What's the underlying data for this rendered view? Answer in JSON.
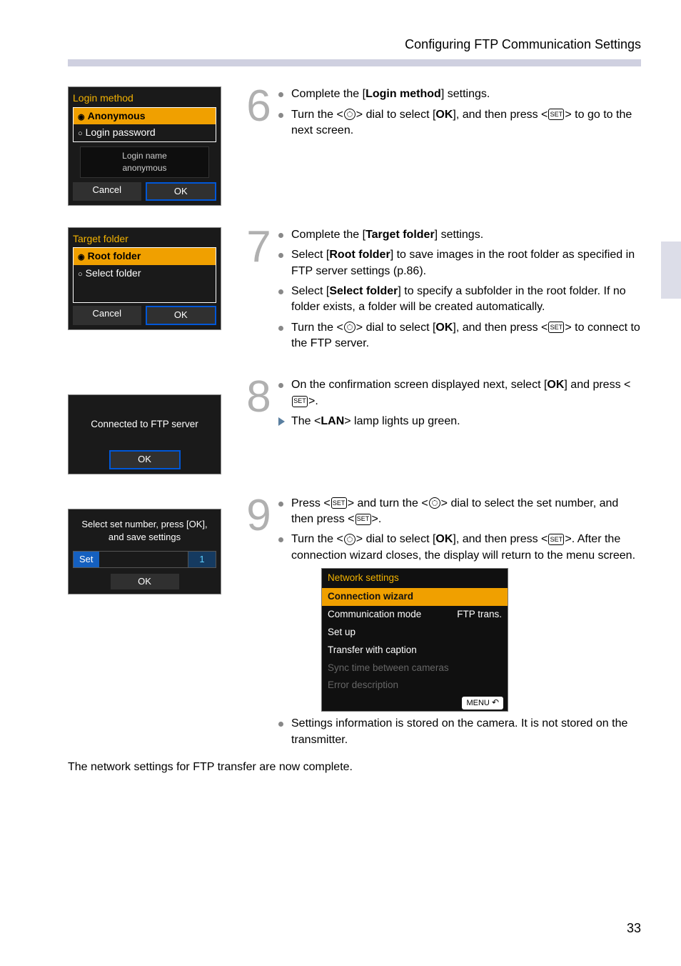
{
  "header": {
    "title": "Configuring FTP Communication Settings"
  },
  "page_number": "33",
  "steps": {
    "s6": {
      "num": "6",
      "panel": {
        "title": "Login method",
        "opt_sel": "Anonymous",
        "opt_other": "Login password",
        "sub_l1": "Login name",
        "sub_l2": "anonymous",
        "btn_l": "Cancel",
        "btn_r": "OK"
      },
      "b1_a": "Complete the [",
      "b1_bold": "Login method",
      "b1_b": "] settings.",
      "b2_a": "Turn the <",
      "b2_b": "> dial to select [",
      "b2_ok": "OK",
      "b2_c": "], and then press <",
      "b2_d": "> to go to the next screen."
    },
    "s7": {
      "num": "7",
      "panel": {
        "title": "Target folder",
        "opt_sel": "Root folder",
        "opt_other": "Select folder",
        "btn_l": "Cancel",
        "btn_r": "OK"
      },
      "b1_a": "Complete the [",
      "b1_bold": "Target folder",
      "b1_b": "] settings.",
      "b2_a": "Select [",
      "b2_bold": "Root folder",
      "b2_b": "] to save images in the root folder as specified in FTP server settings (p.86).",
      "b3_a": "Select [",
      "b3_bold": "Select folder",
      "b3_b": "] to specify a subfolder in the root folder. If no folder exists, a folder will be created automatically.",
      "b4_a": "Turn the <",
      "b4_b": "> dial to select [",
      "b4_ok": "OK",
      "b4_c": "], and then press <",
      "b4_d": "> to connect to the FTP server."
    },
    "s8": {
      "num": "8",
      "panel": {
        "msg": "Connected to FTP server",
        "btn": "OK"
      },
      "b1_a": "On the confirmation screen displayed next, select [",
      "b1_ok": "OK",
      "b1_b": "] and press <",
      "b1_c": ">.",
      "b2_a": "The <",
      "b2_lan": "LAN",
      "b2_b": "> lamp lights up green."
    },
    "s9": {
      "num": "9",
      "panel": {
        "msg_l1": "Select set number, press [OK],",
        "msg_l2": "and save settings",
        "set_lbl": "Set",
        "set_val": "1",
        "btn": "OK"
      },
      "b1_a": "Press <",
      "b1_b": "> and turn the <",
      "b1_c": "> dial to select the set number, and then press <",
      "b1_d": ">.",
      "b2_a": "Turn the <",
      "b2_b": "> dial to select [",
      "b2_ok": "OK",
      "b2_c": "], and then press <",
      "b2_d": ">. After the connection wizard closes, the display will return to the menu screen.",
      "ns": {
        "title": "Network settings",
        "i1": "Connection wizard",
        "i2a": "Communication mode",
        "i2b": "FTP trans.",
        "i3": "Set up",
        "i4": "Transfer with caption",
        "i5": "Sync time between cameras",
        "i6": "Error description",
        "menu": "MENU"
      },
      "b3": "Settings information is stored on the camera. It is not stored on the transmitter."
    }
  },
  "final": "The network settings for FTP transfer are now complete.",
  "icons": {
    "set": "SET"
  }
}
